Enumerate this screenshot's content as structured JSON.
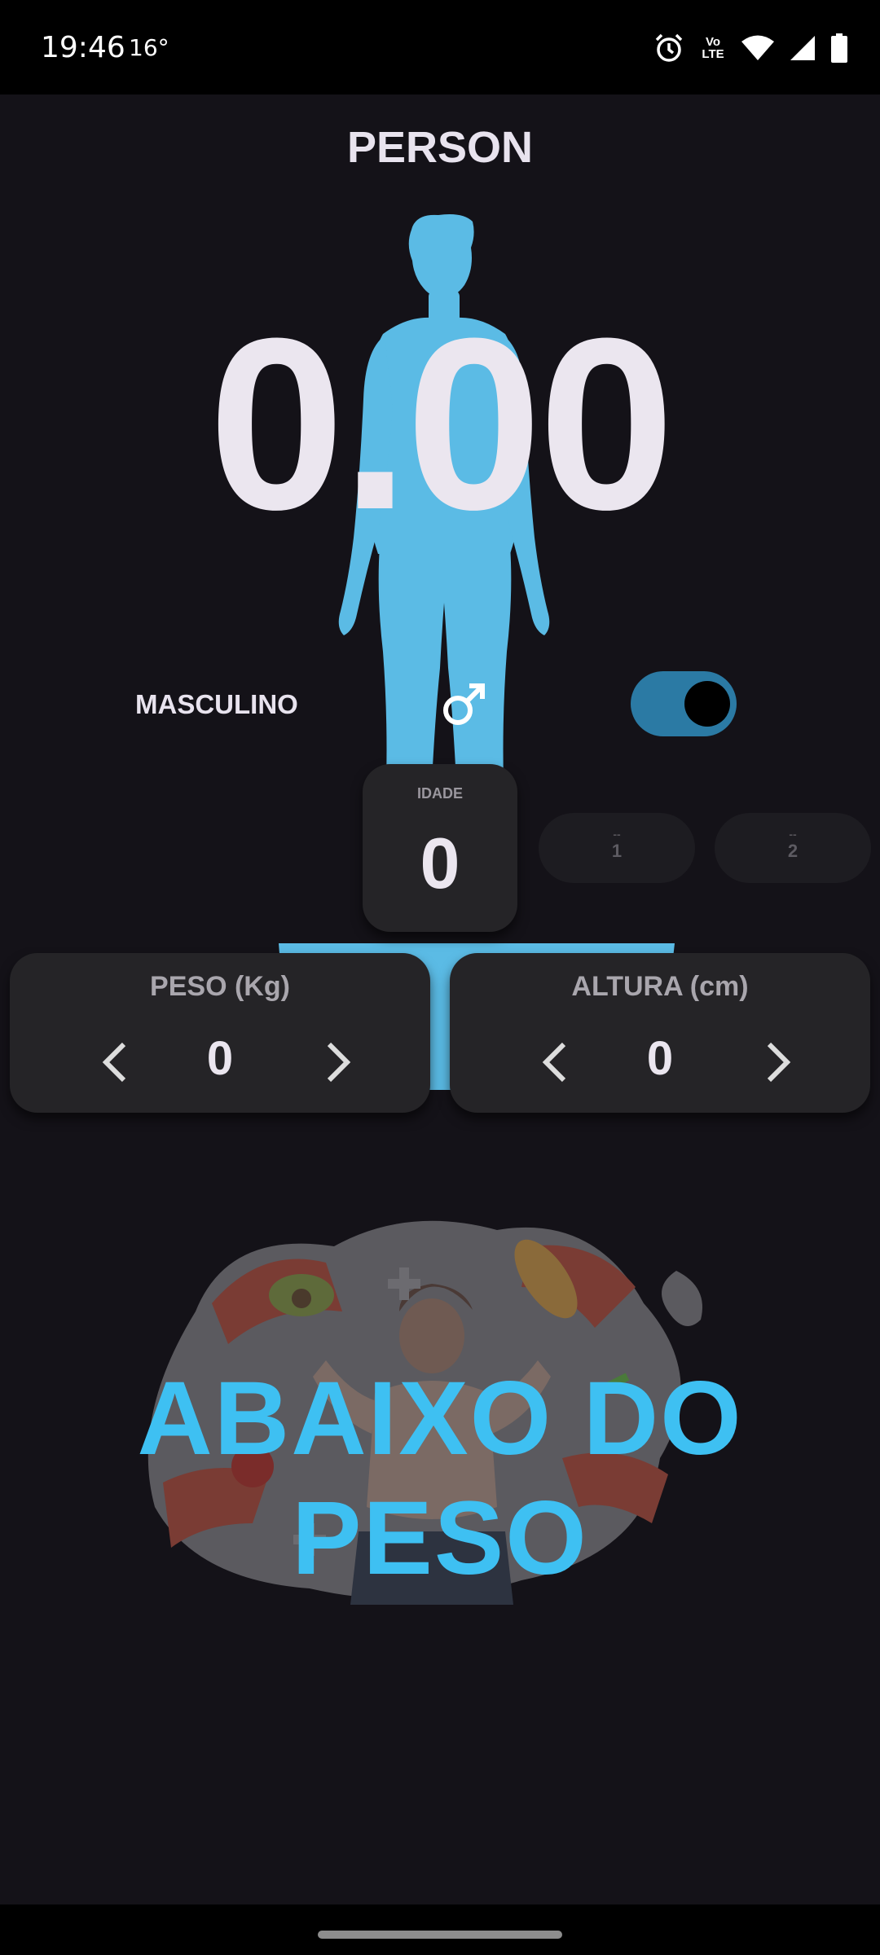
{
  "status_bar": {
    "time": "19:46",
    "temperature": "16°",
    "icons": [
      "alarm-icon",
      "volte-icon",
      "wifi-icon",
      "signal-icon",
      "battery-icon"
    ],
    "volte_text": "Vo LTE"
  },
  "header": {
    "title": "PERSON"
  },
  "bmi": {
    "value": "0.00"
  },
  "gender": {
    "label": "MASCULINO",
    "icon": "male-symbol-icon",
    "toggle_on": true
  },
  "age": {
    "label": "IDADE",
    "value": "0"
  },
  "age_slots": [
    {
      "dash": "--",
      "value": "1"
    },
    {
      "dash": "--",
      "value": "2"
    }
  ],
  "weight": {
    "title": "PESO (Kg)",
    "value": "0"
  },
  "height": {
    "title": "ALTURA (cm)",
    "value": "0"
  },
  "result": {
    "text": "ABAIXO DO PESO"
  },
  "colors": {
    "accent": "#3ec0f2",
    "figure": "#5bbbe5",
    "background": "#141218",
    "card": "#252427",
    "toggle_track": "#2b7aa4"
  }
}
